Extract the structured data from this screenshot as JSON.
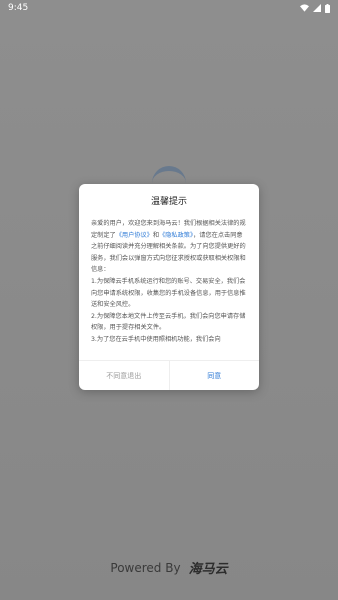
{
  "status_bar": {
    "time": "9:45",
    "icons": [
      "wifi-icon",
      "signal-icon",
      "battery-icon"
    ]
  },
  "footer": {
    "powered_by": "Powered By",
    "brand": "海马云"
  },
  "dialog": {
    "title": "温馨提示",
    "p1_a": "亲爱的用户，欢迎您来到海马云！我们根据相关法律的规定制定了",
    "link_user_agreement": "《用户协议》",
    "and": "和",
    "link_privacy": "《隐私政策》",
    "p1_b": "，请您在点击同意之前仔细阅读并充分理解相关条款。为了向您提供更好的服务，我们会以弹窗方式向您征求授权或获取相关权限和信息：",
    "p2": "1.为保障云手机系统运行和您的账号、交易安全，我们会向您申请系统权限，收集您的手机设备信息，用于信息推送和安全风控。",
    "p3": "2.为保障您本地文件上传至云手机，我们会向您申请存储权限，用于提存相关文件。",
    "p4": "3.为了您在云手机中使用照相机功能，我们会向",
    "decline_label": "不同意退出",
    "agree_label": "同意"
  },
  "colors": {
    "link": "#2f7bd6",
    "scrim": "#8a8a8a"
  }
}
